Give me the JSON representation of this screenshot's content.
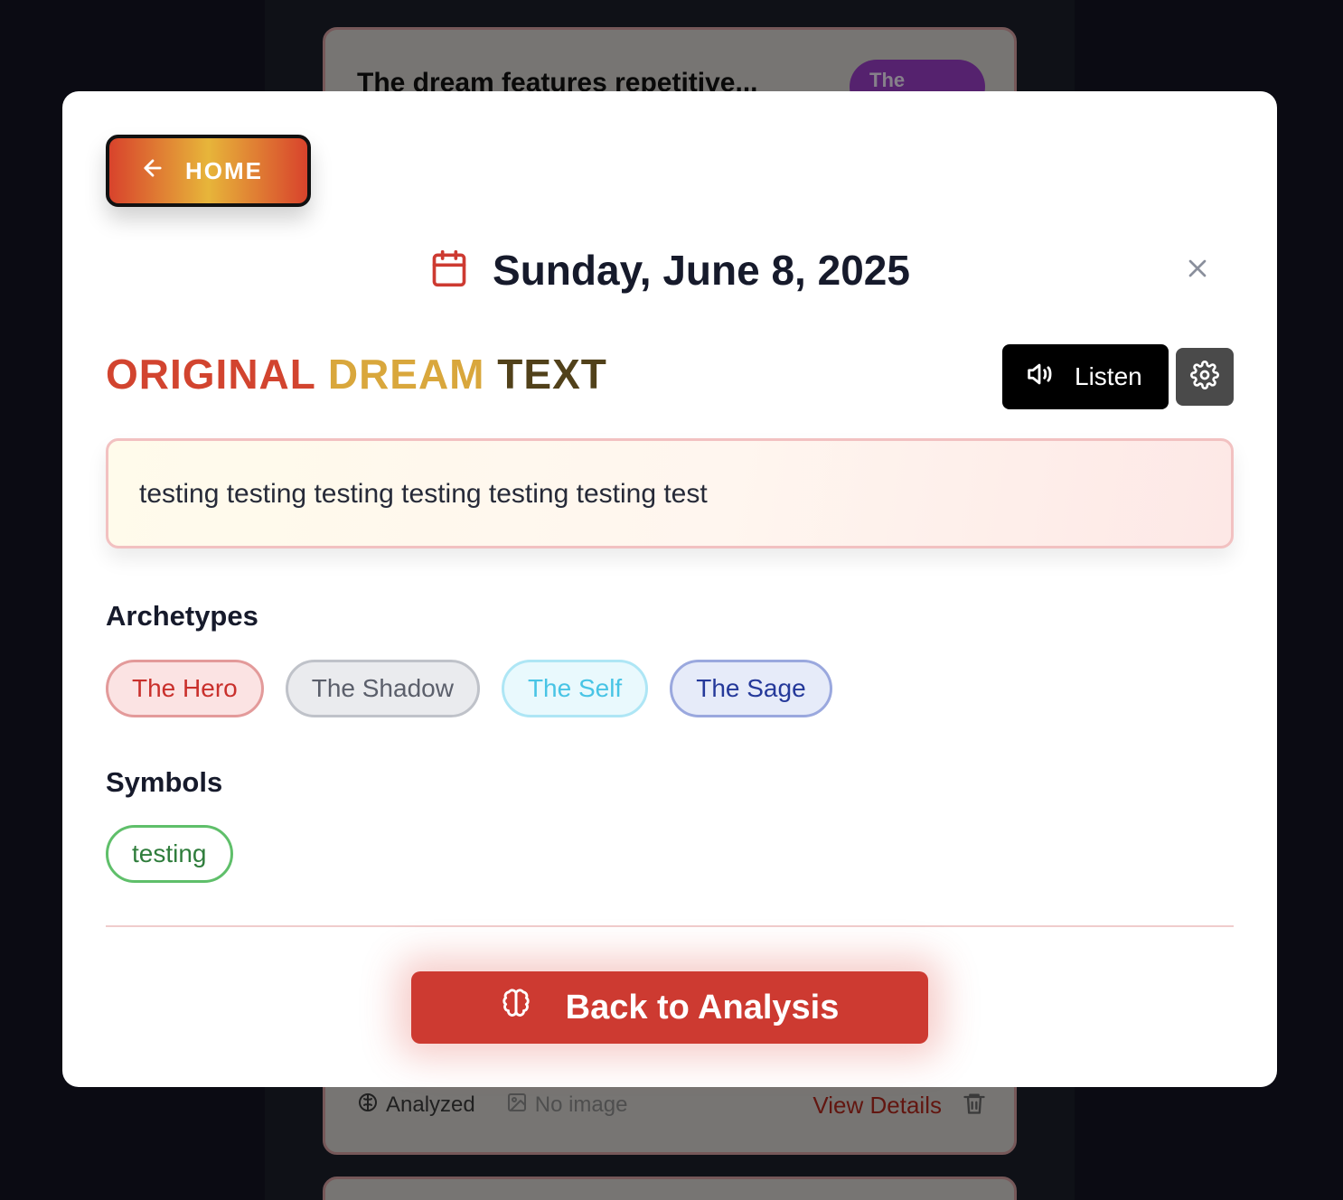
{
  "background": {
    "top_card": {
      "title": "The dream features repetitive...",
      "pill": "The"
    },
    "bottom_card": {
      "analyzed": "Analyzed",
      "no_image": "No image",
      "view_details": "View Details"
    }
  },
  "modal": {
    "home_label": "HOME",
    "date": "Sunday, June 8, 2025",
    "heading": {
      "word1": "ORIGINAL",
      "word2": "DREAM",
      "word3": "TEXT"
    },
    "listen_label": "Listen",
    "dream_text": "testing testing testing testing testing testing test",
    "archetypes_label": "Archetypes",
    "archetypes": [
      "The Hero",
      "The Shadow",
      "The Self",
      "The Sage"
    ],
    "symbols_label": "Symbols",
    "symbols": [
      "testing"
    ],
    "back_to_analysis_label": "Back to Analysis"
  },
  "colors": {
    "accent_red": "#cd3a31",
    "gold": "#e7b53a",
    "calendar_icon": "#cd3a31"
  }
}
